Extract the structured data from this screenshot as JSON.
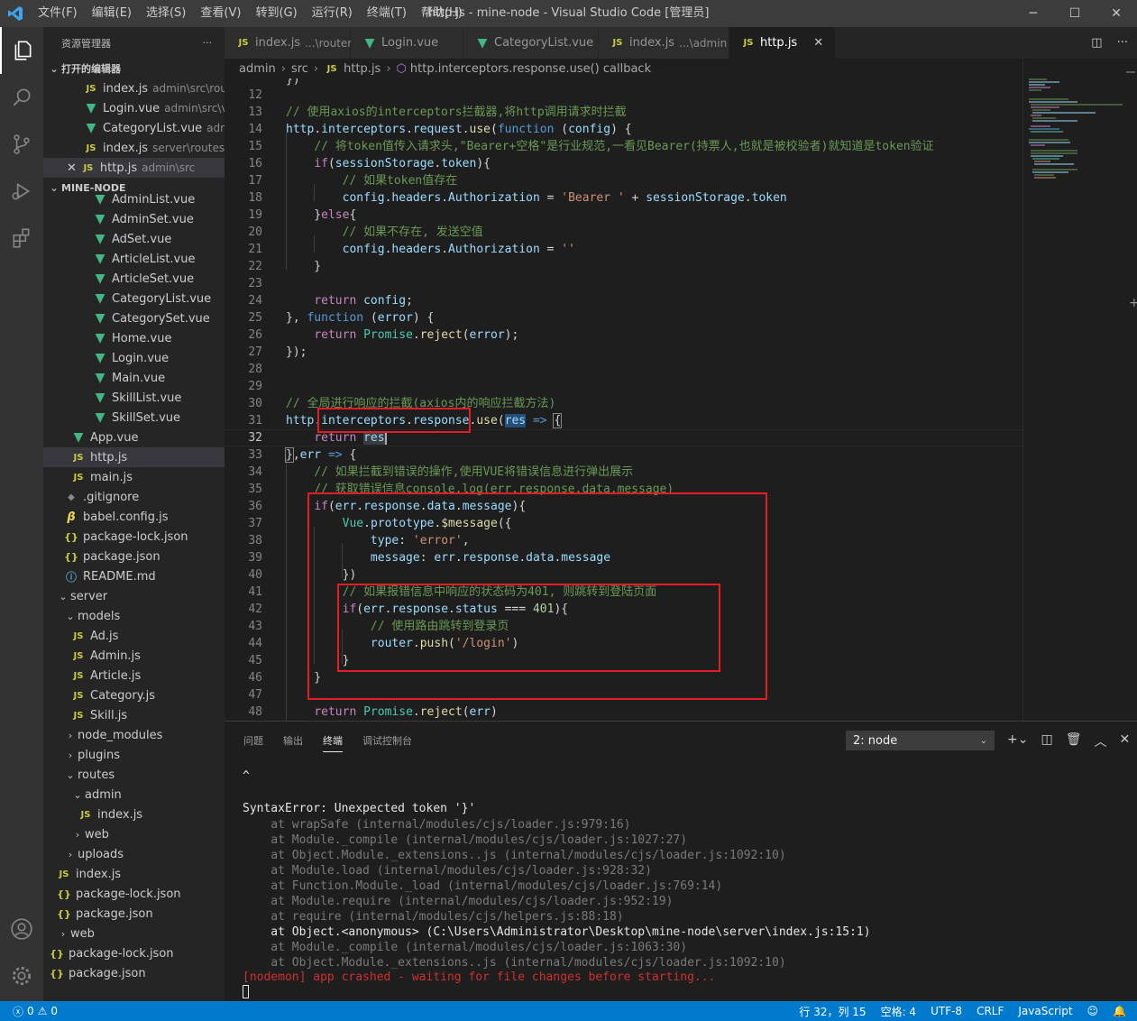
{
  "window": {
    "title": "http.js - mine-node - Visual Studio Code [管理员]",
    "menu": [
      "文件(F)",
      "编辑(E)",
      "选择(S)",
      "查看(V)",
      "转到(G)",
      "运行(R)",
      "终端(T)",
      "帮助(H)"
    ]
  },
  "sidebar": {
    "header": "资源管理器",
    "more": "···",
    "open_editors_label": "打开的编辑器",
    "open_editors": [
      {
        "icon": "JS",
        "name": "index.js",
        "desc": "admin\\src\\router"
      },
      {
        "icon": "V",
        "name": "Login.vue",
        "desc": "admin\\src\\vi..."
      },
      {
        "icon": "V",
        "name": "CategoryList.vue",
        "desc": "admi..."
      },
      {
        "icon": "JS",
        "name": "index.js",
        "desc": "server\\routes\\a..."
      },
      {
        "icon": "JS",
        "name": "http.js",
        "desc": "admin\\src",
        "close": "✕"
      }
    ],
    "project_label": "MINE-NODE",
    "tree": [
      {
        "name": "AdminList.vue",
        "icon": "V"
      },
      {
        "name": "AdminSet.vue",
        "icon": "V"
      },
      {
        "name": "AdSet.vue",
        "icon": "V"
      },
      {
        "name": "ArticleList.vue",
        "icon": "V"
      },
      {
        "name": "ArticleSet.vue",
        "icon": "V"
      },
      {
        "name": "CategoryList.vue",
        "icon": "V"
      },
      {
        "name": "CategorySet.vue",
        "icon": "V"
      },
      {
        "name": "Home.vue",
        "icon": "V"
      },
      {
        "name": "Login.vue",
        "icon": "V"
      },
      {
        "name": "Main.vue",
        "icon": "V"
      },
      {
        "name": "SkillList.vue",
        "icon": "V"
      },
      {
        "name": "SkillSet.vue",
        "icon": "V"
      },
      {
        "name": "App.vue",
        "icon": "V"
      },
      {
        "name": "http.js",
        "icon": "JS"
      },
      {
        "name": "main.js",
        "icon": "JS"
      },
      {
        "name": ".gitignore",
        "icon": "◆"
      },
      {
        "name": "babel.config.js",
        "icon": "B"
      },
      {
        "name": "package-lock.json",
        "icon": "{}"
      },
      {
        "name": "package.json",
        "icon": "{}"
      },
      {
        "name": "README.md",
        "icon": "ⓘ"
      },
      {
        "name": "server",
        "icon": "⌄"
      },
      {
        "name": "models",
        "icon": "⌄"
      },
      {
        "name": "Ad.js",
        "icon": "JS"
      },
      {
        "name": "Admin.js",
        "icon": "JS"
      },
      {
        "name": "Article.js",
        "icon": "JS"
      },
      {
        "name": "Category.js",
        "icon": "JS"
      },
      {
        "name": "Skill.js",
        "icon": "JS"
      },
      {
        "name": "node_modules",
        "icon": "›"
      },
      {
        "name": "plugins",
        "icon": "›"
      },
      {
        "name": "routes",
        "icon": "⌄"
      },
      {
        "name": "admin",
        "icon": "⌄"
      },
      {
        "name": "index.js",
        "icon": "JS"
      },
      {
        "name": "web",
        "icon": "›"
      },
      {
        "name": "uploads",
        "icon": "›"
      },
      {
        "name": "index.js",
        "icon": "JS"
      },
      {
        "name": "package-lock.json",
        "icon": "{}"
      },
      {
        "name": "package.json",
        "icon": "{}"
      },
      {
        "name": "web",
        "icon": "›"
      },
      {
        "name": "package-lock.json",
        "icon": "{}"
      },
      {
        "name": "package.json",
        "icon": "{}"
      }
    ]
  },
  "tabs": [
    {
      "icon": "JS",
      "name": "index.js",
      "desc": "...\\router"
    },
    {
      "icon": "V",
      "name": "Login.vue",
      "desc": ""
    },
    {
      "icon": "V",
      "name": "CategoryList.vue",
      "desc": ""
    },
    {
      "icon": "JS",
      "name": "index.js",
      "desc": "...\\admin"
    },
    {
      "icon": "JS",
      "name": "http.js",
      "desc": "",
      "close": "✕"
    }
  ],
  "breadcrumbs": [
    "admin",
    "src",
    "http.js",
    "http.interceptors.response.use() callback"
  ],
  "editor": {
    "top_partial": "})",
    "lines": [
      12,
      13,
      14,
      15,
      16,
      17,
      18,
      19,
      20,
      21,
      22,
      23,
      24,
      25,
      26,
      27,
      28,
      29,
      30,
      31,
      32,
      33,
      34,
      35,
      36,
      37,
      38,
      39,
      40,
      41,
      42,
      43,
      44,
      45,
      46,
      47,
      48
    ],
    "current_line": 32
  },
  "panel": {
    "tabs": [
      "问题",
      "输出",
      "终端",
      "调试控制台"
    ],
    "active_tab": "终端",
    "terminal_select": "2: node",
    "caret": "^",
    "error_line": "SyntaxError: Unexpected token '}'",
    "stack": [
      "    at wrapSafe (internal/modules/cjs/loader.js:979:16)",
      "    at Module._compile (internal/modules/cjs/loader.js:1027:27)",
      "    at Object.Module._extensions..js (internal/modules/cjs/loader.js:1092:10)",
      "    at Module.load (internal/modules/cjs/loader.js:928:32)",
      "    at Function.Module._load (internal/modules/cjs/loader.js:769:14)",
      "    at Module.require (internal/modules/cjs/loader.js:952:19)",
      "    at require (internal/modules/cjs/helpers.js:88:18)",
      "    at Object.<anonymous> (C:\\Users\\Administrator\\Desktop\\mine-node\\server\\index.js:15:1)",
      "    at Module._compile (internal/modules/cjs/loader.js:1063:30)",
      "    at Object.Module._extensions..js (internal/modules/cjs/loader.js:1092:10)"
    ],
    "crash_line": "[nodemon] app crashed - waiting for file changes before starting..."
  },
  "statusbar": {
    "errors": "0",
    "warnings": "0",
    "position": "行 32，列 15",
    "spaces": "空格: 4",
    "encoding": "UTF-8",
    "eol": "CRLF",
    "language": "JavaScript"
  },
  "colors": {
    "accent": "#007acc",
    "red_box": "#e51c23"
  }
}
